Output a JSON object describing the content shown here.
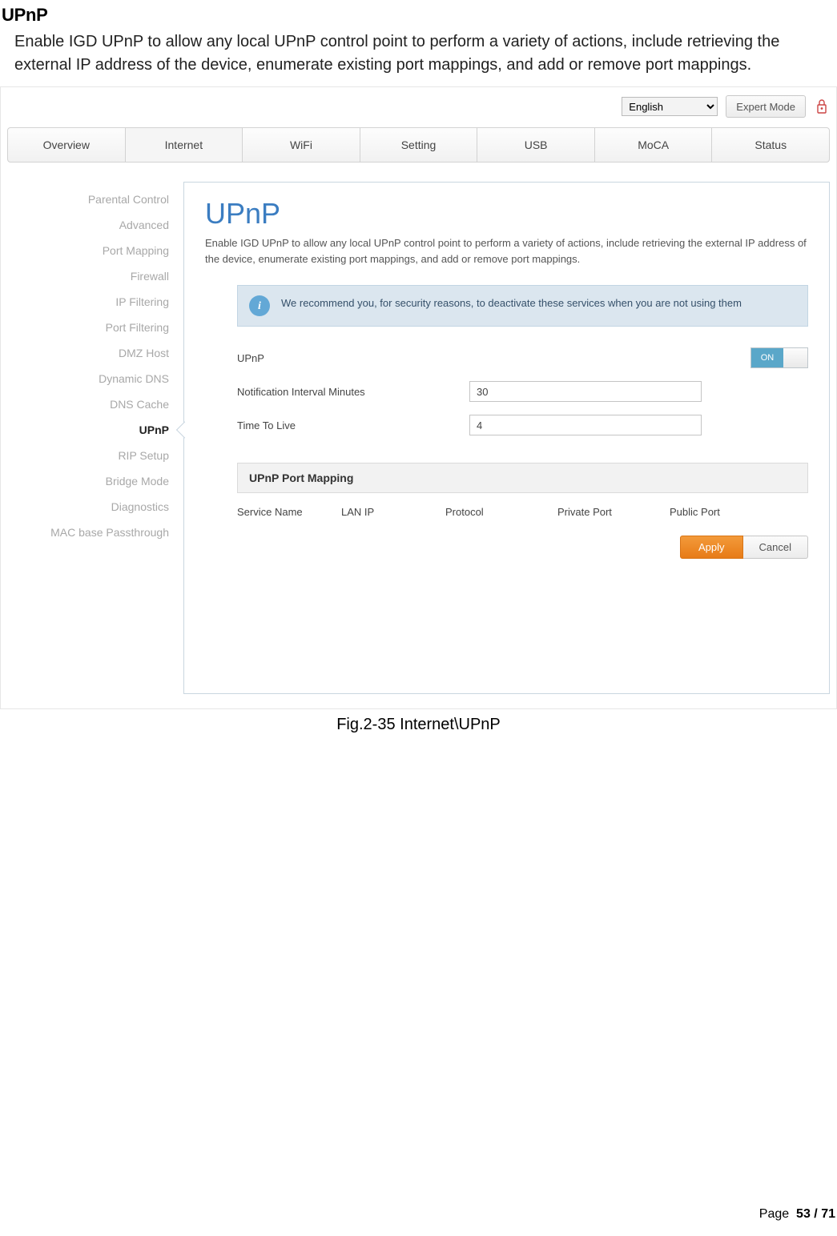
{
  "doc": {
    "title": "UPnP",
    "desc": "Enable IGD UPnP to allow any local UPnP control point to perform a variety of actions, include retrieving the external IP address of the device, enumerate existing port mappings, and add or remove port mappings.",
    "caption": "Fig.2-35 Internet\\UPnP",
    "page_label": "Page",
    "page_cur": "53",
    "page_sep": "/",
    "page_total": "71"
  },
  "top": {
    "lang": "English",
    "expert": "Expert Mode"
  },
  "tabs": [
    "Overview",
    "Internet",
    "WiFi",
    "Setting",
    "USB",
    "MoCA",
    "Status"
  ],
  "sidebar": [
    "Parental Control",
    "Advanced",
    "Port Mapping",
    "Firewall",
    "IP Filtering",
    "Port Filtering",
    "DMZ Host",
    "Dynamic DNS",
    "DNS Cache",
    "UPnP",
    "RIP Setup",
    "Bridge Mode",
    "Diagnostics",
    "MAC base Passthrough"
  ],
  "panel": {
    "title": "UPnP",
    "desc": "Enable IGD UPnP to allow any local UPnP control point to perform a variety of actions, include retrieving the external IP address of the device, enumerate existing port mappings, and add or remove port mappings.",
    "info": "We recommend you, for security reasons, to deactivate these services when you are not using them",
    "upnp_label": "UPnP",
    "upnp_on": "ON",
    "interval_label": "Notification Interval Minutes",
    "interval_value": "30",
    "ttl_label": "Time To Live",
    "ttl_value": "4",
    "section": "UPnP Port Mapping",
    "cols": {
      "service": "Service Name",
      "lan": "LAN IP",
      "proto": "Protocol",
      "priv": "Private Port",
      "pub": "Public Port"
    },
    "apply": "Apply",
    "cancel": "Cancel"
  }
}
